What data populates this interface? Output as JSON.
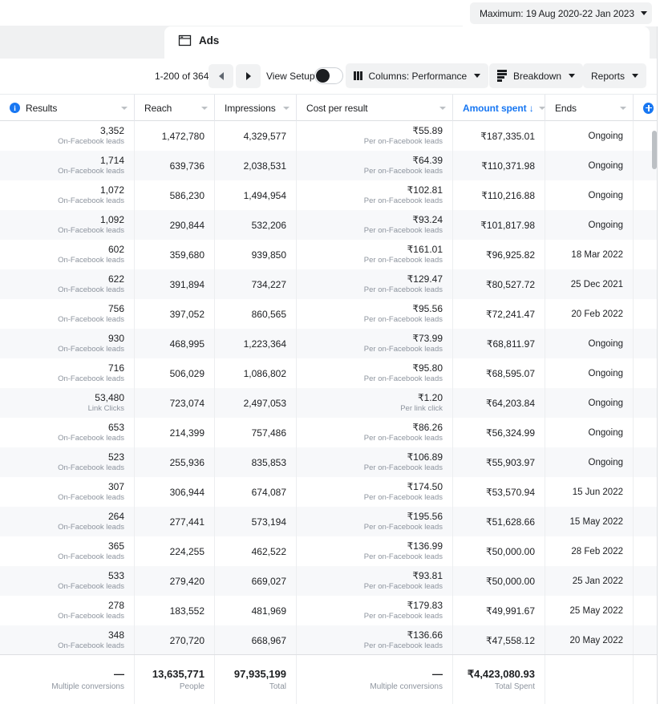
{
  "topbar": {
    "date_range_label": "Maximum: 19 Aug 2020-22 Jan 2023",
    "caret_icon": "chevron-down-icon"
  },
  "tabs": {
    "active": "Ads",
    "ads_label": "Ads",
    "ads_icon": "ads-window-icon"
  },
  "toolbar": {
    "pagination_label": "1-200 of 364",
    "prev_icon": "triangle-left-icon",
    "next_icon": "triangle-right-icon",
    "view_setup_label": "View Setup",
    "view_setup_on": true,
    "columns_label": "Columns: Performance",
    "columns_icon": "columns-icon",
    "breakdown_label": "Breakdown",
    "breakdown_icon": "breakdown-icon",
    "reports_label": "Reports"
  },
  "table": {
    "columns": [
      {
        "key": "results",
        "label": "Results",
        "has_info_icon": true,
        "sorted": false
      },
      {
        "key": "reach",
        "label": "Reach",
        "has_info_icon": false,
        "sorted": false
      },
      {
        "key": "impr",
        "label": "Impressions",
        "has_info_icon": false,
        "sorted": false
      },
      {
        "key": "cpr",
        "label": "Cost per result",
        "has_info_icon": false,
        "sorted": false
      },
      {
        "key": "spent",
        "label": "Amount spent ↓",
        "has_info_icon": false,
        "sorted": true
      },
      {
        "key": "ends",
        "label": "Ends",
        "has_info_icon": false,
        "sorted": false
      }
    ],
    "add_column_icon": "plus-circle-icon",
    "rows": [
      {
        "results": "3,352",
        "results_sub": "On-Facebook leads",
        "reach": "1,472,780",
        "impr": "4,329,577",
        "cpr": "₹55.89",
        "cpr_sub": "Per on-Facebook leads",
        "spent": "₹187,335.01",
        "ends": "Ongoing"
      },
      {
        "results": "1,714",
        "results_sub": "On-Facebook leads",
        "reach": "639,736",
        "impr": "2,038,531",
        "cpr": "₹64.39",
        "cpr_sub": "Per on-Facebook leads",
        "spent": "₹110,371.98",
        "ends": "Ongoing"
      },
      {
        "results": "1,072",
        "results_sub": "On-Facebook leads",
        "reach": "586,230",
        "impr": "1,494,954",
        "cpr": "₹102.81",
        "cpr_sub": "Per on-Facebook leads",
        "spent": "₹110,216.88",
        "ends": "Ongoing"
      },
      {
        "results": "1,092",
        "results_sub": "On-Facebook leads",
        "reach": "290,844",
        "impr": "532,206",
        "cpr": "₹93.24",
        "cpr_sub": "Per on-Facebook leads",
        "spent": "₹101,817.98",
        "ends": "Ongoing"
      },
      {
        "results": "602",
        "results_sub": "On-Facebook leads",
        "reach": "359,680",
        "impr": "939,850",
        "cpr": "₹161.01",
        "cpr_sub": "Per on-Facebook leads",
        "spent": "₹96,925.82",
        "ends": "18 Mar 2022"
      },
      {
        "results": "622",
        "results_sub": "On-Facebook leads",
        "reach": "391,894",
        "impr": "734,227",
        "cpr": "₹129.47",
        "cpr_sub": "Per on-Facebook leads",
        "spent": "₹80,527.72",
        "ends": "25 Dec 2021"
      },
      {
        "results": "756",
        "results_sub": "On-Facebook leads",
        "reach": "397,052",
        "impr": "860,565",
        "cpr": "₹95.56",
        "cpr_sub": "Per on-Facebook leads",
        "spent": "₹72,241.47",
        "ends": "20 Feb 2022"
      },
      {
        "results": "930",
        "results_sub": "On-Facebook leads",
        "reach": "468,995",
        "impr": "1,223,364",
        "cpr": "₹73.99",
        "cpr_sub": "Per on-Facebook leads",
        "spent": "₹68,811.97",
        "ends": "Ongoing"
      },
      {
        "results": "716",
        "results_sub": "On-Facebook leads",
        "reach": "506,029",
        "impr": "1,086,802",
        "cpr": "₹95.80",
        "cpr_sub": "Per on-Facebook leads",
        "spent": "₹68,595.07",
        "ends": "Ongoing"
      },
      {
        "results": "53,480",
        "results_sub": "Link Clicks",
        "reach": "723,074",
        "impr": "2,497,053",
        "cpr": "₹1.20",
        "cpr_sub": "Per link click",
        "spent": "₹64,203.84",
        "ends": "Ongoing"
      },
      {
        "results": "653",
        "results_sub": "On-Facebook leads",
        "reach": "214,399",
        "impr": "757,486",
        "cpr": "₹86.26",
        "cpr_sub": "Per on-Facebook leads",
        "spent": "₹56,324.99",
        "ends": "Ongoing"
      },
      {
        "results": "523",
        "results_sub": "On-Facebook leads",
        "reach": "255,936",
        "impr": "835,853",
        "cpr": "₹106.89",
        "cpr_sub": "Per on-Facebook leads",
        "spent": "₹55,903.97",
        "ends": "Ongoing"
      },
      {
        "results": "307",
        "results_sub": "On-Facebook leads",
        "reach": "306,944",
        "impr": "674,087",
        "cpr": "₹174.50",
        "cpr_sub": "Per on-Facebook leads",
        "spent": "₹53,570.94",
        "ends": "15 Jun 2022"
      },
      {
        "results": "264",
        "results_sub": "On-Facebook leads",
        "reach": "277,441",
        "impr": "573,194",
        "cpr": "₹195.56",
        "cpr_sub": "Per on-Facebook leads",
        "spent": "₹51,628.66",
        "ends": "15 May 2022"
      },
      {
        "results": "365",
        "results_sub": "On-Facebook leads",
        "reach": "224,255",
        "impr": "462,522",
        "cpr": "₹136.99",
        "cpr_sub": "Per on-Facebook leads",
        "spent": "₹50,000.00",
        "ends": "28 Feb 2022"
      },
      {
        "results": "533",
        "results_sub": "On-Facebook leads",
        "reach": "279,420",
        "impr": "669,027",
        "cpr": "₹93.81",
        "cpr_sub": "Per on-Facebook leads",
        "spent": "₹50,000.00",
        "ends": "25 Jan 2022"
      },
      {
        "results": "278",
        "results_sub": "On-Facebook leads",
        "reach": "183,552",
        "impr": "481,969",
        "cpr": "₹179.83",
        "cpr_sub": "Per on-Facebook leads",
        "spent": "₹49,991.67",
        "ends": "25 May 2022"
      },
      {
        "results": "348",
        "results_sub": "On-Facebook leads",
        "reach": "270,720",
        "impr": "668,967",
        "cpr": "₹136.66",
        "cpr_sub": "Per on-Facebook leads",
        "spent": "₹47,558.12",
        "ends": "20 May 2022"
      }
    ],
    "summary": {
      "results": "—",
      "results_sub": "Multiple conversions",
      "reach": "13,635,771",
      "reach_sub": "People",
      "impr": "97,935,199",
      "impr_sub": "Total",
      "cpr": "—",
      "cpr_sub": "Multiple conversions",
      "spent": "₹4,423,080.93",
      "spent_sub": "Total Spent",
      "ends": "",
      "ends_sub": ""
    }
  },
  "colors": {
    "accent": "#1877f2",
    "text": "#1c1e21",
    "muted": "#8d949e",
    "row_alt": "#f7f8fa",
    "chrome": "#f0f1f2"
  }
}
